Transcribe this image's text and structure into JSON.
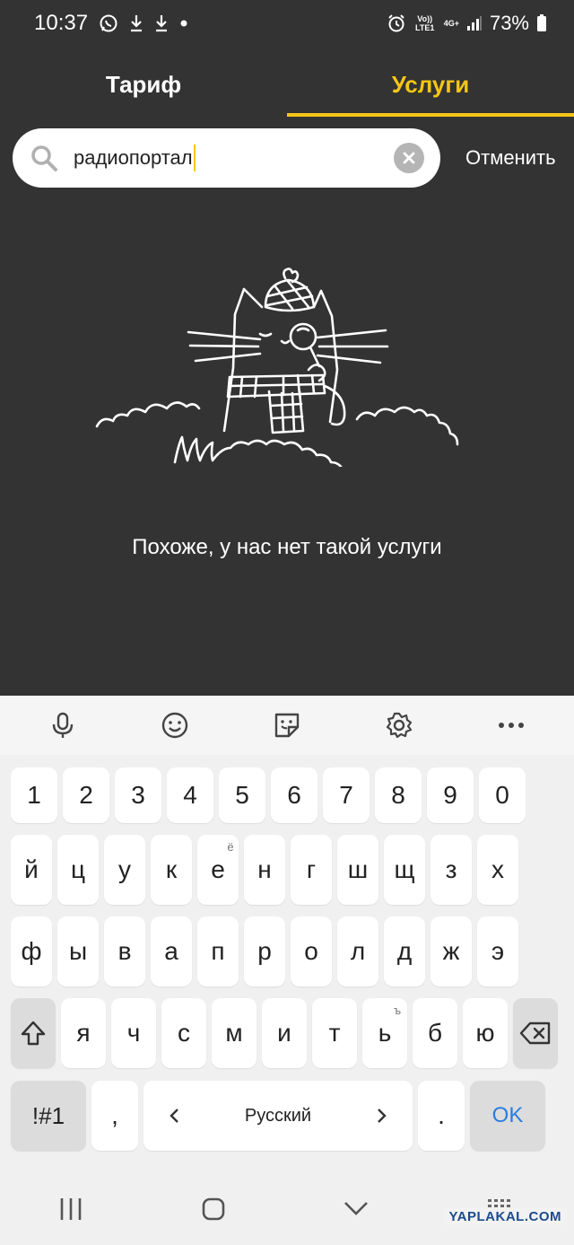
{
  "status_bar": {
    "time": "10:37",
    "network_top": "Vo)) LTE1",
    "network_gen": "4G+",
    "battery": "73%"
  },
  "tabs": [
    {
      "label": "Тариф",
      "active": false
    },
    {
      "label": "Услуги",
      "active": true
    }
  ],
  "search": {
    "value": "радиопортал",
    "cancel_label": "Отменить"
  },
  "empty_state": {
    "message": "Похоже, у нас нет такой услуги"
  },
  "keyboard": {
    "number_row": [
      "1",
      "2",
      "3",
      "4",
      "5",
      "6",
      "7",
      "8",
      "9",
      "0"
    ],
    "row1": [
      "й",
      "ц",
      "у",
      "к",
      "е",
      "н",
      "г",
      "ш",
      "щ",
      "з",
      "х"
    ],
    "row1_sup": {
      "4": "ё"
    },
    "row2": [
      "ф",
      "ы",
      "в",
      "а",
      "п",
      "р",
      "о",
      "л",
      "д",
      "ж",
      "э"
    ],
    "row3": [
      "я",
      "ч",
      "с",
      "м",
      "и",
      "т",
      "ь",
      "б",
      "ю"
    ],
    "row3_sup": {
      "6": "ъ"
    },
    "symbols_label": "!#1",
    "comma": ",",
    "space_label": "Русский",
    "period": ".",
    "ok_label": "OK"
  },
  "watermark": "YAPLAKAL.COM",
  "colors": {
    "accent": "#f5c518",
    "background": "#333333",
    "ok": "#2a7de1"
  }
}
